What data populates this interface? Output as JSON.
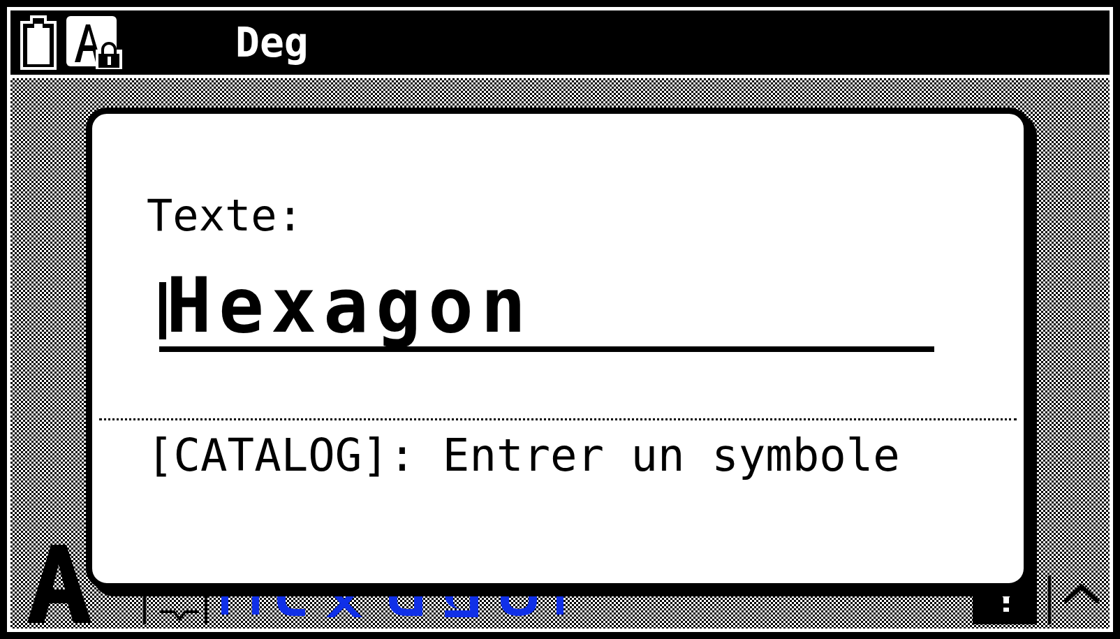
{
  "status_bar": {
    "angle_mode": "Deg"
  },
  "dialog": {
    "label": "Texte:",
    "input_value": "Hexagon",
    "hint": "[CATALOG]: Entrer un symbole"
  }
}
